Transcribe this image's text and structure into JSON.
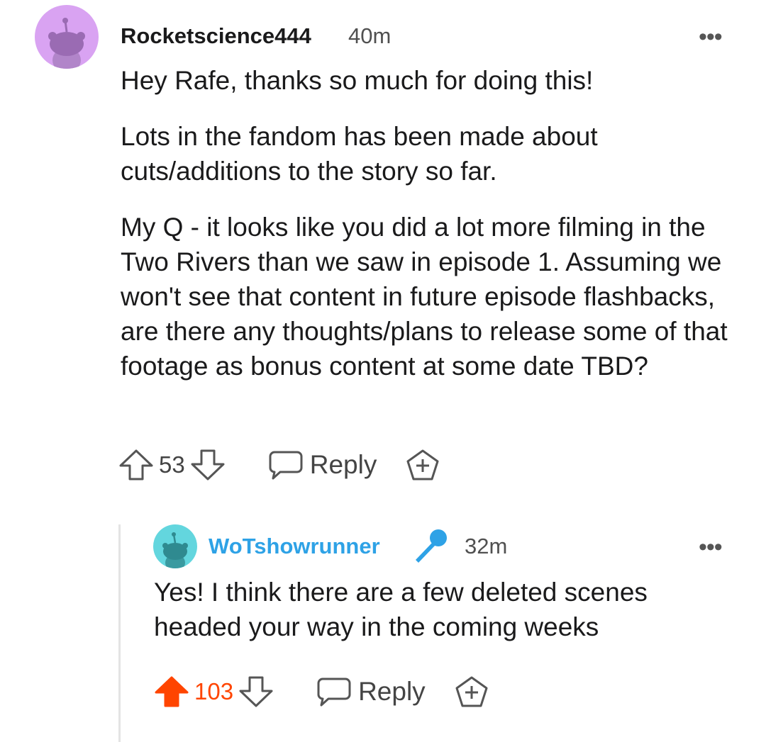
{
  "comments": [
    {
      "username": "Rocketscience444",
      "time": "40m",
      "more_label": "•••",
      "avatar_color": "#d9a3f2",
      "paragraphs": [
        "Hey Rafe, thanks so much for doing this!",
        "Lots in the fandom has been made about cuts/additions to the story so far.",
        "My Q - it looks like you did a lot more filming in the Two Rivers than we saw in episode 1. Assuming we won't see that content in future episode flashbacks, are there any thoughts/plans to release some of that footage as bonus content at some date TBD?"
      ],
      "score": "53",
      "upvoted": false,
      "reply_label": "Reply"
    },
    {
      "username": "WoTshowrunner",
      "username_color": "#2ea2e6",
      "flair_icon": "microphone-icon",
      "time": "32m",
      "more_label": "•••",
      "avatar_color": "#63d6de",
      "paragraphs": [
        "Yes! I think there are a few deleted scenes headed your way in the coming weeks"
      ],
      "score": "103",
      "upvoted": true,
      "upvote_color": "#ff4500",
      "reply_label": "Reply"
    }
  ]
}
